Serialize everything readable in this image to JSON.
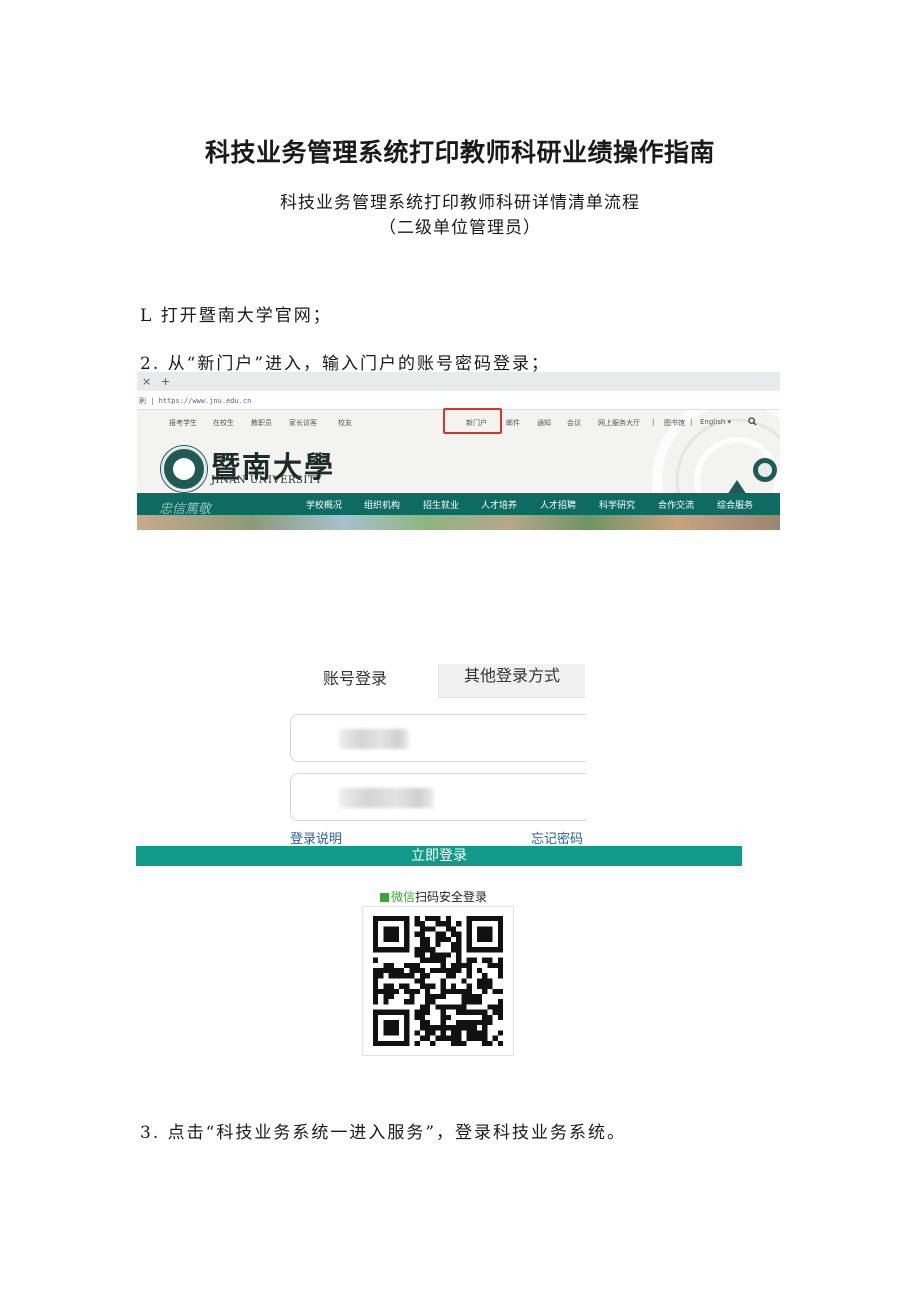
{
  "document": {
    "title": "科技业务管理系统打印教师科研业绩操作指南",
    "subtitle": "科技业务管理系统打印教师科研详情清单流程",
    "subtitle2": "（二级单位管理员）",
    "step1": "L 打开暨南大学官网；",
    "step2": "2. 从“新门户”进入，输入门户的账号密码登录；",
    "step3": "3. 点击“科技业务系统一进入服务”，登录科技业务系统。"
  },
  "browser": {
    "tab_close": "×",
    "tab_add": "+",
    "url": "刷 | https://www.jnu.edu.cn"
  },
  "site": {
    "top_links_left": [
      "报考学生",
      "在校生",
      "教职员",
      "家长访客",
      "校友"
    ],
    "top_links_right": [
      "新门户",
      "邮件",
      "通知",
      "会议",
      "网上服务大厅",
      "|",
      "图书馆",
      "|",
      "English ▾"
    ],
    "search_icon": "search-icon",
    "logo_cn": "暨南大學",
    "logo_en": "JINAN UNIVERSITY",
    "motto": "忠信篤敬",
    "nav": [
      "学校概况",
      "组织机构",
      "招生就业",
      "人才培养",
      "人才招聘",
      "科学研究",
      "合作交流",
      "综合服务"
    ],
    "highlight_color": "#d9342b",
    "nav_color": "#0d6b62"
  },
  "login": {
    "tab_account": "账号登录",
    "tab_other": "其他登录方式",
    "help_link": "登录说明",
    "forgot_link": "忘记密码",
    "submit": "立即登录",
    "wechat_label_green": "微信",
    "wechat_label_rest": "扫码安全登录",
    "button_color": "#119a87"
  }
}
